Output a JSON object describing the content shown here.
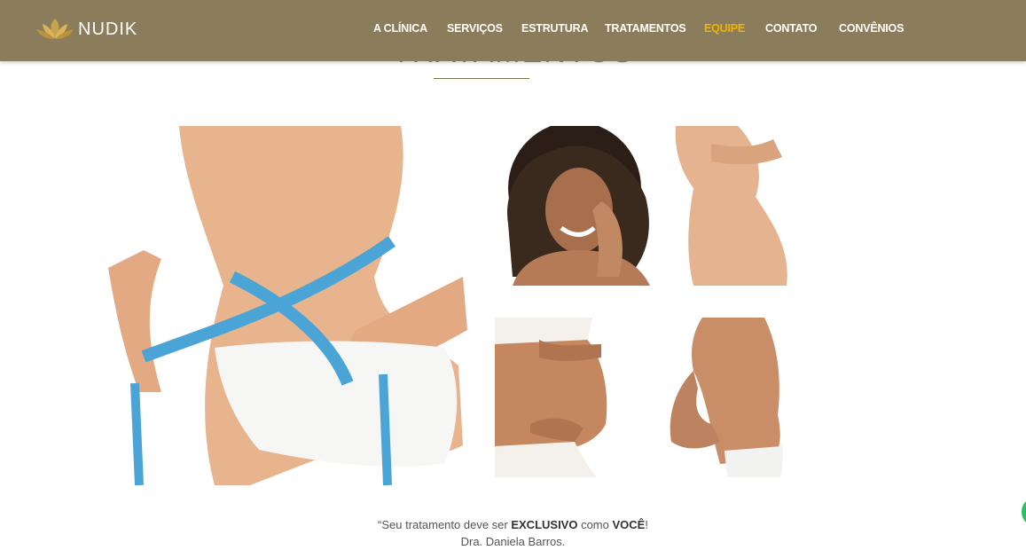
{
  "brand": {
    "name": "NUDIK",
    "color": "#8b7d5c",
    "accent": "#f5b400"
  },
  "nav": {
    "items": [
      {
        "label": "A CLÍNICA",
        "active": false
      },
      {
        "label": "SERVIÇOS",
        "active": false
      },
      {
        "label": "ESTRUTURA",
        "active": false
      },
      {
        "label": "TRATAMENTOS",
        "active": false
      },
      {
        "label": "EQUIPE",
        "active": true
      },
      {
        "label": "CONTATO",
        "active": false
      },
      {
        "label": "CONVÊNIOS",
        "active": false
      }
    ]
  },
  "section": {
    "title": "TRATAMENTOS"
  },
  "quote": {
    "open": "“Seu tratamento deve ser ",
    "strong1": "EXCLUSIVO",
    "middle": " como ",
    "strong2": "VOCÊ",
    "close": "!",
    "author": "Dra. Daniela Barros."
  },
  "icons": {
    "logo": "lotus-icon",
    "chat": "whatsapp-chat-icon"
  }
}
